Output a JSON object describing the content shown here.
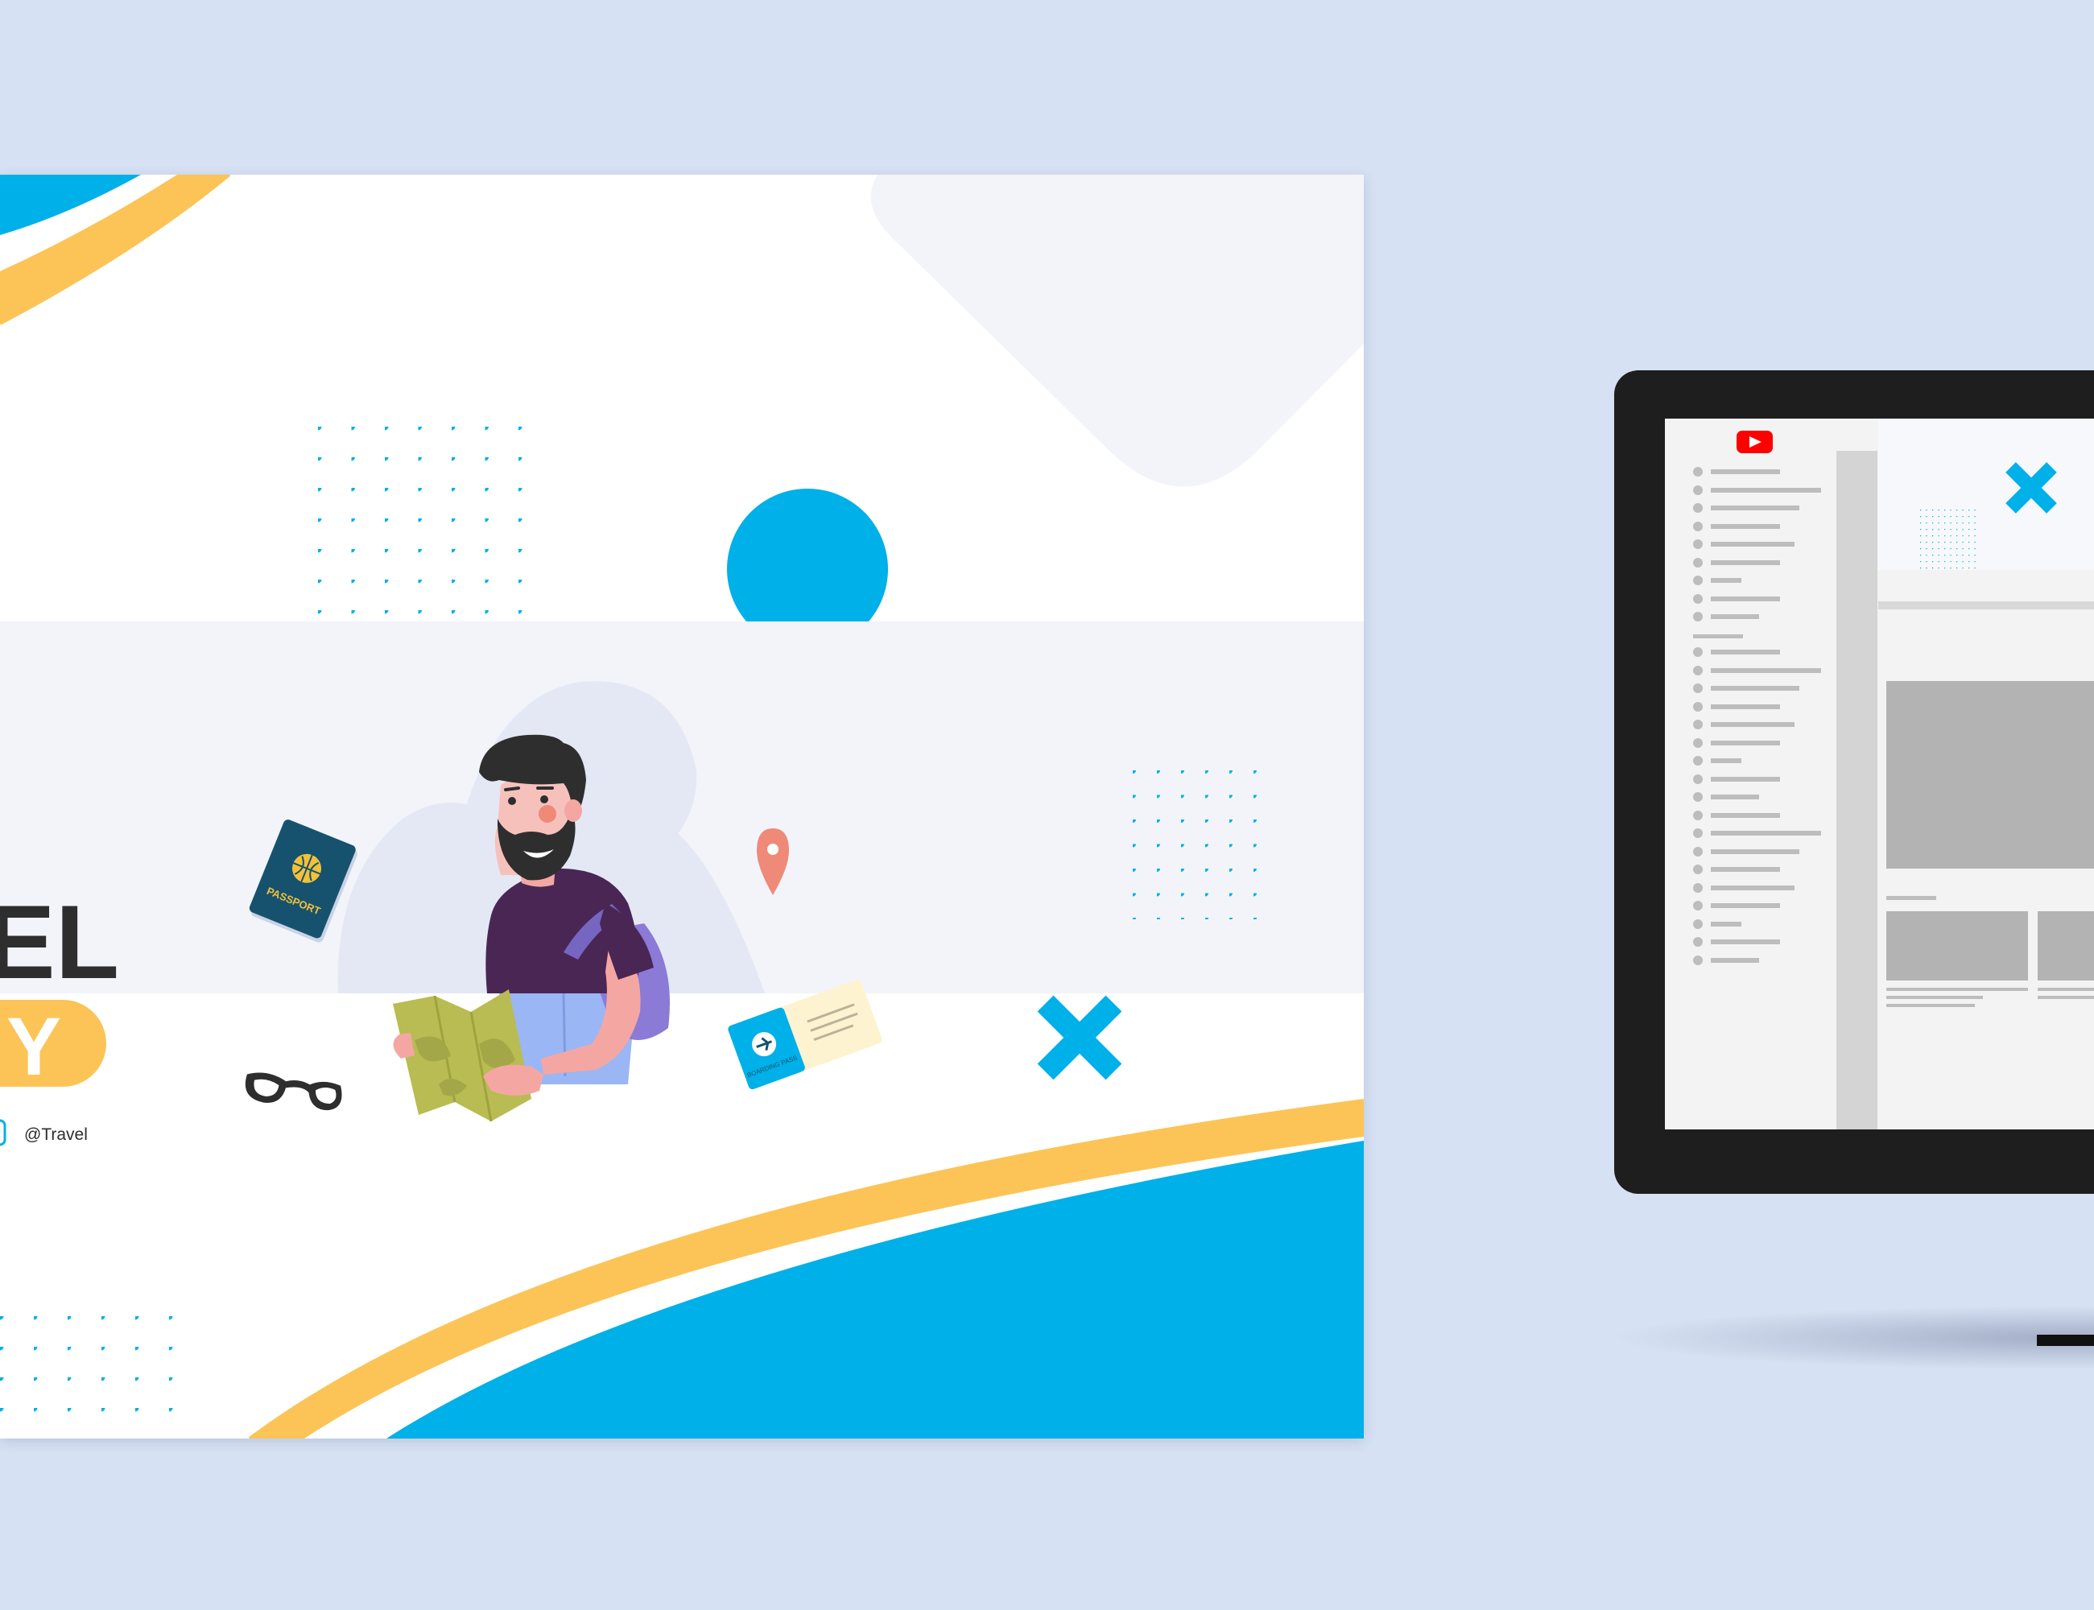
{
  "banner": {
    "title_partial": "EL",
    "badge_partial": "Y",
    "handle": "@Travel",
    "passport_label": "PASSPORT",
    "ticket_label": "BOARDING PASS"
  },
  "colors": {
    "background": "#d6e1f3",
    "accent_blue": "#00b0e8",
    "accent_yellow": "#fcc457",
    "text_dark": "#2e2e2e",
    "shirt": "#4a2655",
    "backpack": "#8b7ad6",
    "map": "#b8bc52",
    "pin": "#ef8a78",
    "monitor_frame": "#1e1e1e",
    "youtube_red": "#ff0000"
  },
  "icons": {
    "cross": "cross-icon",
    "pin": "location-pin-icon",
    "passport": "passport-icon",
    "glasses": "glasses-icon",
    "ticket": "ticket-icon",
    "youtube": "youtube-logo-icon",
    "social": "social-icon"
  }
}
